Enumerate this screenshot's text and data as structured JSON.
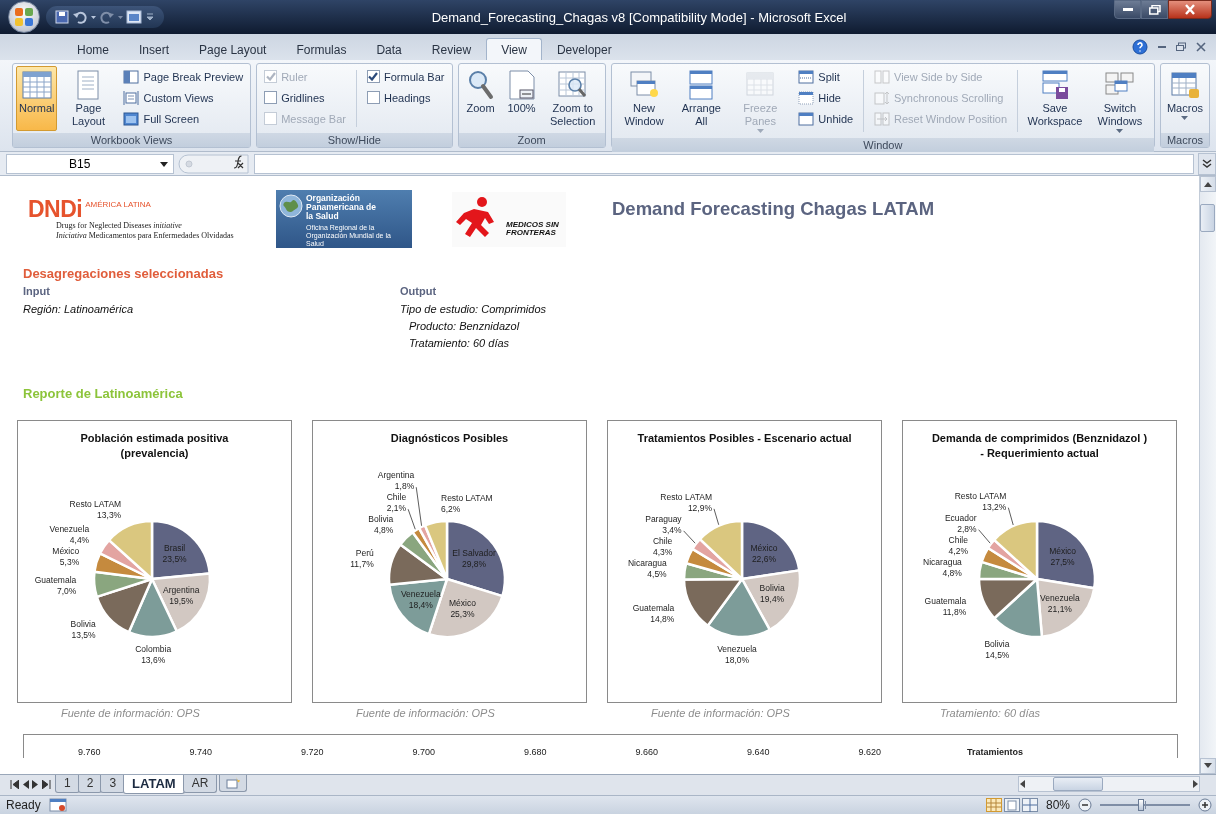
{
  "window": {
    "title": "Demand_Forecasting_Chagas v8  [Compatibility Mode] - Microsoft Excel"
  },
  "ribbon": {
    "tabs": [
      {
        "label": "Home",
        "selected": false
      },
      {
        "label": "Insert",
        "selected": false
      },
      {
        "label": "Page Layout",
        "selected": false
      },
      {
        "label": "Formulas",
        "selected": false
      },
      {
        "label": "Data",
        "selected": false
      },
      {
        "label": "Review",
        "selected": false
      },
      {
        "label": "View",
        "selected": true
      },
      {
        "label": "Developer",
        "selected": false
      }
    ],
    "groups": [
      {
        "name": "Workbook Views",
        "items": [
          {
            "kind": "large",
            "label": "Normal",
            "selected": true,
            "disabled": false,
            "dropdown": false
          },
          {
            "kind": "large",
            "label": "Page Layout",
            "selected": false,
            "disabled": false,
            "dropdown": false
          },
          {
            "kind": "small",
            "label": "Page Break Preview",
            "selected": false,
            "disabled": false
          },
          {
            "kind": "small",
            "label": "Custom Views",
            "selected": false,
            "disabled": false
          },
          {
            "kind": "small",
            "label": "Full Screen",
            "selected": false,
            "disabled": false
          }
        ]
      },
      {
        "name": "Show/Hide",
        "items": [
          {
            "kind": "checkbox",
            "label": "Ruler",
            "checked": true,
            "disabled": true
          },
          {
            "kind": "checkbox",
            "label": "Gridlines",
            "checked": false,
            "disabled": false
          },
          {
            "kind": "checkbox",
            "label": "Message Bar",
            "checked": false,
            "disabled": true
          },
          {
            "kind": "checkbox",
            "label": "Formula Bar",
            "checked": true,
            "disabled": false
          },
          {
            "kind": "checkbox",
            "label": "Headings",
            "checked": false,
            "disabled": false
          }
        ]
      },
      {
        "name": "Zoom",
        "items": [
          {
            "kind": "large",
            "label": "Zoom",
            "disabled": false,
            "dropdown": false
          },
          {
            "kind": "large",
            "label": "100%",
            "disabled": false,
            "dropdown": false
          },
          {
            "kind": "large",
            "label": "Zoom to Selection",
            "disabled": false,
            "dropdown": false
          }
        ]
      },
      {
        "name": "Window",
        "items": [
          {
            "kind": "large",
            "label": "New Window",
            "disabled": false,
            "dropdown": false
          },
          {
            "kind": "large",
            "label": "Arrange All",
            "disabled": false,
            "dropdown": false
          },
          {
            "kind": "large",
            "label": "Freeze Panes",
            "disabled": true,
            "dropdown": true
          },
          {
            "kind": "small",
            "label": "Split",
            "disabled": false
          },
          {
            "kind": "small",
            "label": "Hide",
            "disabled": false
          },
          {
            "kind": "small",
            "label": "Unhide",
            "disabled": false
          },
          {
            "kind": "small",
            "label": "View Side by Side",
            "disabled": true
          },
          {
            "kind": "small",
            "label": "Synchronous Scrolling",
            "disabled": true
          },
          {
            "kind": "small",
            "label": "Reset Window Position",
            "disabled": true
          },
          {
            "kind": "large",
            "label": "Save Workspace",
            "disabled": false,
            "dropdown": false
          },
          {
            "kind": "large",
            "label": "Switch Windows",
            "disabled": false,
            "dropdown": true
          }
        ]
      },
      {
        "name": "Macros",
        "items": [
          {
            "kind": "large",
            "label": "Macros",
            "disabled": false,
            "dropdown": true
          }
        ]
      }
    ]
  },
  "formula_bar": {
    "name_box": "B15"
  },
  "sheet": {
    "logos": {
      "dndi": {
        "name": "DNDi",
        "region": "AMÉRICA LATINA",
        "line_1": "Drugs for Neglected Diseases *initiative*",
        "line_2": "*Iniciativa* Medicamentos para Enfermedades Olvidadas"
      },
      "paho": {
        "name": "Organización Panamericana de la Salud",
        "subtitle": "Oficina Regional de la Organización Mundial de la Salud"
      },
      "msf": {
        "name": "MEDICOS SIN FRONTERAS"
      }
    },
    "title": "Demand Forecasting Chagas LATAM",
    "selection_heading": "Desagregaciones seleccionadas",
    "input": {
      "heading": "Input",
      "lines": [
        "Región: Latinoamérica"
      ]
    },
    "output": {
      "heading": "Output",
      "lines": [
        "Tipo de estudio: Comprimidos",
        "Producto: Benznidazol",
        "Tratamiento: 60 días"
      ]
    },
    "report_heading": "Reporte de Latinoamérica",
    "charts": [
      {
        "caption": "Fuente de información: OPS",
        "chart_data": {
          "type": "pie",
          "title": "Población estimada positiva\n(prevalencia)",
          "categories": [
            "Brasil",
            "Argentina",
            "Colombia",
            "Bolivia",
            "Guatemala",
            "México",
            "Venezuela",
            "Resto LATAM"
          ],
          "values": [
            23.5,
            19.5,
            13.6,
            13.5,
            7.0,
            5.3,
            4.4,
            13.3
          ],
          "value_labels": [
            "23,5%",
            "19,5%",
            "13,6%",
            "13,5%",
            "7,0%",
            "5,3%",
            "4,4%",
            "13,3%"
          ]
        }
      },
      {
        "caption": "Fuente de información: OPS",
        "chart_data": {
          "type": "pie",
          "title": "Diagnósticos Posibles",
          "categories": [
            "El Salvador",
            "México",
            "Venezuela",
            "Perú",
            "Bolivia",
            "Chile",
            "Argentina",
            "Resto LATAM"
          ],
          "values": [
            29.8,
            25.3,
            18.4,
            11.7,
            4.8,
            2.1,
            1.8,
            6.2
          ],
          "value_labels": [
            "29,8%",
            "25,3%",
            "18,4%",
            "11,7%",
            "4,8%",
            "2,1%",
            "1,8%",
            "6,2%"
          ]
        }
      },
      {
        "caption": "Fuente de información: OPS",
        "chart_data": {
          "type": "pie",
          "title": "Tratamientos Posibles - Escenario actual",
          "categories": [
            "México",
            "Bolivia",
            "Venezuela",
            "Guatemala",
            "Nicaragua",
            "Chile",
            "Paraguay",
            "Resto LATAM"
          ],
          "values": [
            22.6,
            19.4,
            18.0,
            14.8,
            4.5,
            4.3,
            3.4,
            12.9
          ],
          "value_labels": [
            "22,6%",
            "19,4%",
            "18,0%",
            "14,8%",
            "4,5%",
            "4,3%",
            "3,4%",
            "12,9%"
          ]
        }
      },
      {
        "caption": "Tratamiento: 60 días",
        "chart_data": {
          "type": "pie",
          "title": "Demanda de comprimidos (Benznidazol )\n- Requerimiento actual",
          "categories": [
            "México",
            "Venezuela",
            "Bolivia",
            "Guatemala",
            "Nicaragua",
            "Chile",
            "Ecuador",
            "Resto LATAM"
          ],
          "values": [
            27.5,
            21.1,
            14.5,
            11.8,
            4.8,
            4.2,
            2.8,
            13.2
          ],
          "value_labels": [
            "27,5%",
            "21,1%",
            "14,5%",
            "11,8%",
            "4,8%",
            "4,2%",
            "2,8%",
            "13,2%"
          ]
        }
      }
    ],
    "partial_chart": {
      "axis_labels": [
        "9.760",
        "9.740",
        "9.720",
        "9.700",
        "9.680",
        "9.660",
        "9.640",
        "9.620"
      ],
      "legend": "Tratamientos"
    }
  },
  "sheet_tabs": [
    {
      "label": "1",
      "selected": false
    },
    {
      "label": "2",
      "selected": false
    },
    {
      "label": "3",
      "selected": false
    },
    {
      "label": "LATAM",
      "selected": true
    },
    {
      "label": "AR",
      "selected": false
    }
  ],
  "status_bar": {
    "status": "Ready",
    "zoom": "80%",
    "zoom_slider": {
      "level": 0.45
    }
  }
}
